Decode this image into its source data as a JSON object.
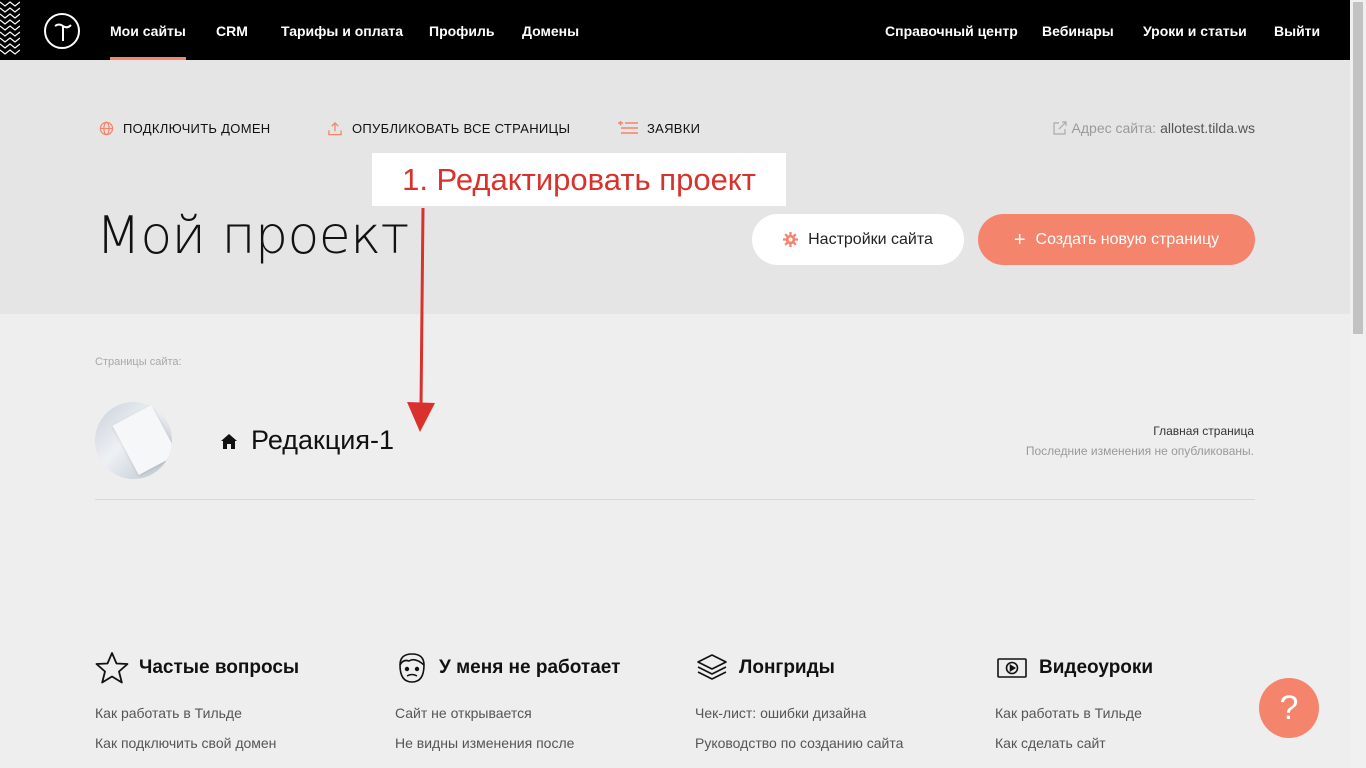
{
  "nav": {
    "items": [
      "Мои сайты",
      "CRM",
      "Тарифы и оплата",
      "Профиль",
      "Домены"
    ],
    "right_items": [
      "Справочный центр",
      "Вебинары",
      "Уроки и статьи",
      "Выйти"
    ]
  },
  "actions": {
    "connect_domain": "ПОДКЛЮЧИТЬ ДОМЕН",
    "publish_all": "ОПУБЛИКОВАТЬ ВСЕ СТРАНИЦЫ",
    "leads": "ЗАЯВКИ",
    "site_address_label": "Адрес сайта:",
    "site_address": "allotest.tilda.ws"
  },
  "project": {
    "title": "Мой проект",
    "settings_label": "Настройки сайта",
    "create_page_label": "Создать новую страницу"
  },
  "annotation": {
    "text": "1. Редактировать проект",
    "color": "#d9322d"
  },
  "pages": {
    "section_label": "Страницы сайта:",
    "items": [
      {
        "name": "Редакция-1",
        "role": "Главная страница",
        "status": "Последние изменения не опубликованы."
      }
    ]
  },
  "help": [
    {
      "icon": "star-icon",
      "title": "Частые вопросы",
      "links": [
        "Как работать в Тильде",
        "Как подключить свой домен"
      ]
    },
    {
      "icon": "confused-face-icon",
      "title": "У меня не работает",
      "links": [
        "Сайт не открывается",
        "Не видны изменения после"
      ]
    },
    {
      "icon": "layers-icon",
      "title": "Лонгриды",
      "links": [
        "Чек-лист: ошибки дизайна",
        "Руководство по созданию сайта"
      ]
    },
    {
      "icon": "video-icon",
      "title": "Видеоуроки",
      "links": [
        "Как работать в Тильде",
        "Как сделать сайт"
      ]
    }
  ],
  "help_button": "?",
  "colors": {
    "accent": "#f4846b",
    "topbar": "#000000",
    "header_bg": "#e6e5e5",
    "page_bg": "#efeeee"
  }
}
